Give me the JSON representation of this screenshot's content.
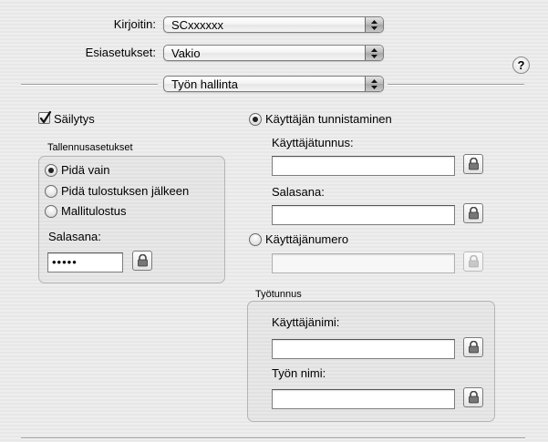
{
  "printer": {
    "label": "Kirjoitin:",
    "value": "SCxxxxxx"
  },
  "presets": {
    "label": "Esiasetukset:",
    "value": "Vakio"
  },
  "pane": {
    "value": "Työn hallinta"
  },
  "help": {
    "glyph": "?"
  },
  "storage": {
    "checkbox_label": "Säilytys",
    "checked": true,
    "group_title": "Tallennusasetukset",
    "options": [
      {
        "label": "Pidä vain",
        "selected": true
      },
      {
        "label": "Pidä tulostuksen jälkeen",
        "selected": false
      },
      {
        "label": "Mallitulostus",
        "selected": false
      }
    ],
    "password_label": "Salasana:",
    "password_value": "•••••"
  },
  "auth": {
    "user_auth_label": "Käyttäjän tunnistaminen",
    "user_auth_selected": true,
    "username_label": "Käyttäjätunnus:",
    "username_value": "",
    "password_label": "Salasana:",
    "password_value": "",
    "user_number_label": "Käyttäjänumero",
    "user_number_selected": false,
    "user_number_value": ""
  },
  "job": {
    "group_title": "Työtunnus",
    "user_name_label": "Käyttäjänimi:",
    "user_name_value": "",
    "job_name_label": "Työn nimi:",
    "job_name_value": ""
  },
  "icons": {
    "popup_arrows": "up-down-arrows-icon",
    "lock": "lock-icon",
    "check": "checkmark-icon"
  }
}
